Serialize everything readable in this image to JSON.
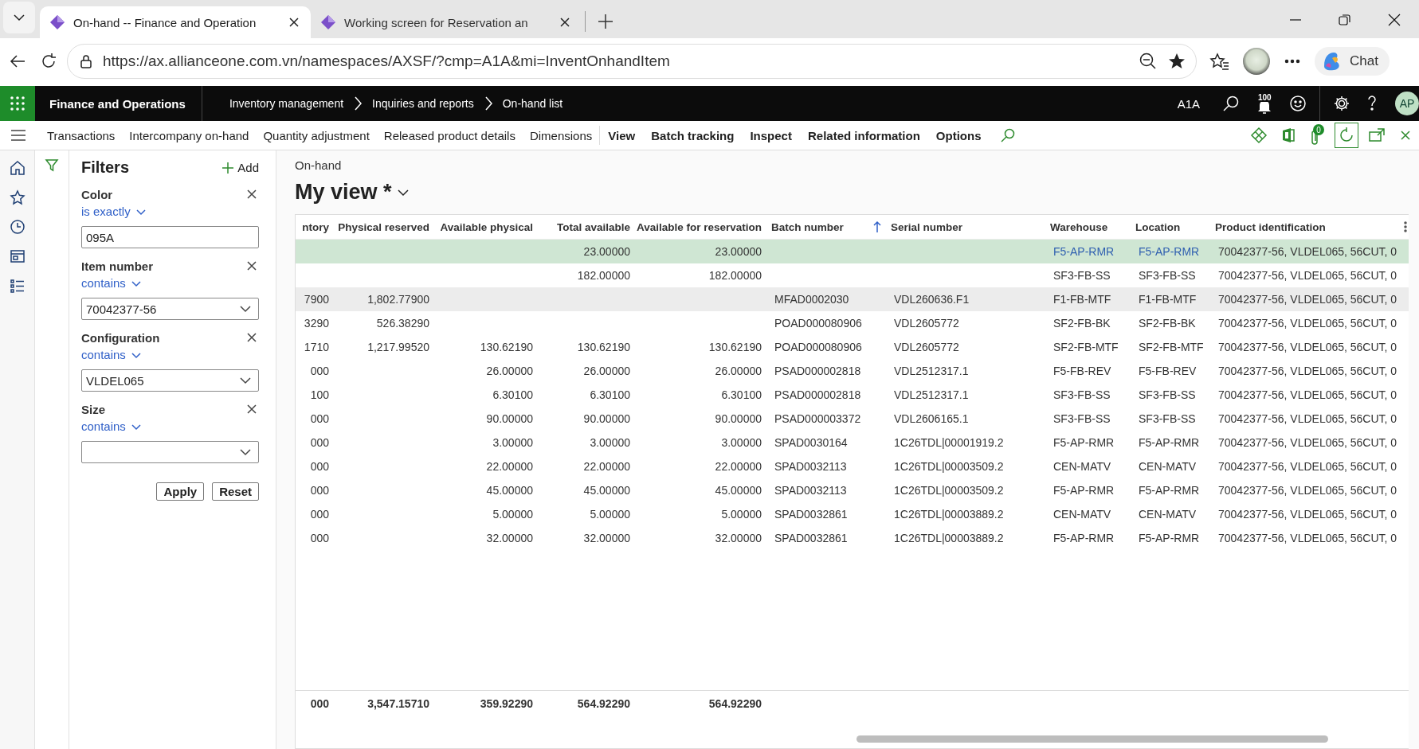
{
  "browser": {
    "tabs": [
      {
        "title": "On-hand -- Finance and Operation",
        "selected": true
      },
      {
        "title": "Working screen for Reservation an",
        "selected": false
      }
    ],
    "url": "https://ax.allianceone.com.vn/namespaces/AXSF/?cmp=A1A&mi=InventOnhandItem",
    "chat": "Chat"
  },
  "app_bar": {
    "title": "Finance and Operations",
    "breadcrumbs": [
      "Inventory management",
      "Inquiries and reports",
      "On-hand list"
    ],
    "company": "A1A",
    "notifications": "100",
    "avatar": "AP"
  },
  "action_pane": {
    "items": [
      {
        "label": "Transactions",
        "kind": "button"
      },
      {
        "label": "Intercompany on-hand",
        "kind": "button"
      },
      {
        "label": "Quantity adjustment",
        "kind": "button"
      },
      {
        "label": "Released product details",
        "kind": "button"
      },
      {
        "label": "Dimensions",
        "kind": "button"
      },
      {
        "label": "View",
        "kind": "menu"
      },
      {
        "label": "Batch tracking",
        "kind": "menu"
      },
      {
        "label": "Inspect",
        "kind": "menu"
      },
      {
        "label": "Related information",
        "kind": "menu"
      },
      {
        "label": "Options",
        "kind": "menu"
      }
    ],
    "attachments": "0"
  },
  "filters": {
    "title": "Filters",
    "add": "Add",
    "fields": [
      {
        "label": "Color",
        "operator": "is exactly",
        "value": "095A",
        "kind": "text"
      },
      {
        "label": "Item number",
        "operator": "contains",
        "value": "70042377-56",
        "kind": "dropdown"
      },
      {
        "label": "Configuration",
        "operator": "contains",
        "value": "VLDEL065",
        "kind": "dropdown"
      },
      {
        "label": "Size",
        "operator": "contains",
        "kind": "dropdown"
      }
    ],
    "buttons": [
      "Apply",
      "Reset"
    ]
  },
  "grid": {
    "caption": "On-hand",
    "view": "My view *",
    "columns": [
      {
        "label": "ntory",
        "kind": "number"
      },
      {
        "label": "Physical reserved",
        "kind": "number"
      },
      {
        "label": "Available physical",
        "kind": "number"
      },
      {
        "label": "Total available",
        "kind": "number"
      },
      {
        "label": "Available for reservation",
        "kind": "number"
      },
      {
        "label": "Batch number",
        "kind": "text",
        "sorted": true
      },
      {
        "label": "Serial number",
        "kind": "text"
      },
      {
        "label": "Warehouse",
        "kind": "text"
      },
      {
        "label": "Location",
        "kind": "text"
      },
      {
        "label": "Product identification",
        "kind": "text"
      }
    ],
    "rows": [
      {
        "selected": true,
        "hovered": false,
        "cells": [
          null,
          null,
          null,
          "23.00000",
          "23.00000",
          null,
          null,
          "F5-AP-RMR",
          "F5-AP-RMR",
          "70042377-56, VLDEL065, 56CUT, 0"
        ]
      },
      {
        "selected": false,
        "hovered": false,
        "cells": [
          null,
          null,
          null,
          "182.00000",
          "182.00000",
          null,
          null,
          "SF3-FB-SS",
          "SF3-FB-SS",
          "70042377-56, VLDEL065, 56CUT, 0"
        ]
      },
      {
        "selected": false,
        "hovered": true,
        "cells": [
          "7900",
          "1,802.77900",
          null,
          null,
          null,
          "MFAD0002030",
          "VDL260636.F1",
          "F1-FB-MTF",
          "F1-FB-MTF",
          "70042377-56, VLDEL065, 56CUT, 0"
        ]
      },
      {
        "selected": false,
        "hovered": false,
        "cells": [
          "3290",
          "526.38290",
          null,
          null,
          null,
          "POAD000080906",
          "VDL2605772",
          "SF2-FB-BK",
          "SF2-FB-BK",
          "70042377-56, VLDEL065, 56CUT, 0"
        ]
      },
      {
        "selected": false,
        "hovered": false,
        "cells": [
          "1710",
          "1,217.99520",
          "130.62190",
          "130.62190",
          "130.62190",
          "POAD000080906",
          "VDL2605772",
          "SF2-FB-MTF",
          "SF2-FB-MTF",
          "70042377-56, VLDEL065, 56CUT, 0"
        ]
      },
      {
        "selected": false,
        "hovered": false,
        "cells": [
          "000",
          null,
          "26.00000",
          "26.00000",
          "26.00000",
          "PSAD000002818",
          "VDL2512317.1",
          "F5-FB-REV",
          "F5-FB-REV",
          "70042377-56, VLDEL065, 56CUT, 0"
        ]
      },
      {
        "selected": false,
        "hovered": false,
        "cells": [
          "100",
          null,
          "6.30100",
          "6.30100",
          "6.30100",
          "PSAD000002818",
          "VDL2512317.1",
          "SF3-FB-SS",
          "SF3-FB-SS",
          "70042377-56, VLDEL065, 56CUT, 0"
        ]
      },
      {
        "selected": false,
        "hovered": false,
        "cells": [
          "000",
          null,
          "90.00000",
          "90.00000",
          "90.00000",
          "PSAD000003372",
          "VDL2606165.1",
          "SF3-FB-SS",
          "SF3-FB-SS",
          "70042377-56, VLDEL065, 56CUT, 0"
        ]
      },
      {
        "selected": false,
        "hovered": false,
        "cells": [
          "000",
          null,
          "3.00000",
          "3.00000",
          "3.00000",
          "SPAD0030164",
          "1C26TDL|00001919.2",
          "F5-AP-RMR",
          "F5-AP-RMR",
          "70042377-56, VLDEL065, 56CUT, 0"
        ]
      },
      {
        "selected": false,
        "hovered": false,
        "cells": [
          "000",
          null,
          "22.00000",
          "22.00000",
          "22.00000",
          "SPAD0032113",
          "1C26TDL|00003509.2",
          "CEN-MATV",
          "CEN-MATV",
          "70042377-56, VLDEL065, 56CUT, 0"
        ]
      },
      {
        "selected": false,
        "hovered": false,
        "cells": [
          "000",
          null,
          "45.00000",
          "45.00000",
          "45.00000",
          "SPAD0032113",
          "1C26TDL|00003509.2",
          "F5-AP-RMR",
          "F5-AP-RMR",
          "70042377-56, VLDEL065, 56CUT, 0"
        ]
      },
      {
        "selected": false,
        "hovered": false,
        "cells": [
          "000",
          null,
          "5.00000",
          "5.00000",
          "5.00000",
          "SPAD0032861",
          "1C26TDL|00003889.2",
          "CEN-MATV",
          "CEN-MATV",
          "70042377-56, VLDEL065, 56CUT, 0"
        ]
      },
      {
        "selected": false,
        "hovered": false,
        "cells": [
          "000",
          null,
          "32.00000",
          "32.00000",
          "32.00000",
          "SPAD0032861",
          "1C26TDL|00003889.2",
          "F5-AP-RMR",
          "F5-AP-RMR",
          "70042377-56, VLDEL065, 56CUT, 0"
        ]
      }
    ],
    "totals": [
      "000",
      "3,547.15710",
      "359.92290",
      "564.92290",
      "564.92290"
    ]
  }
}
